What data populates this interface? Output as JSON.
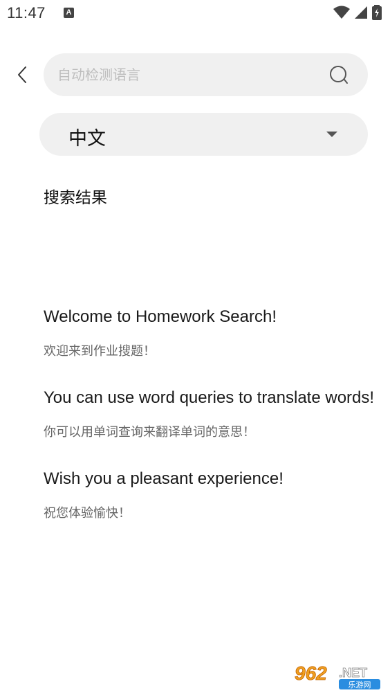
{
  "status_bar": {
    "time": "11:47",
    "notification_badge": "A"
  },
  "search": {
    "placeholder": "自动检测语言",
    "value": ""
  },
  "language_select": {
    "selected": "中文"
  },
  "results": {
    "title": "搜索结果",
    "messages": [
      {
        "en": "Welcome to Homework Search!",
        "zh": "欢迎来到作业搜题！"
      },
      {
        "en": "You can use word queries to translate words!",
        "zh": "你可以用单词查询来翻译单词的意思！"
      },
      {
        "en": "Wish you a pleasant experience!",
        "zh": "祝您体验愉快！"
      }
    ]
  },
  "watermark": {
    "brand": "962.NET",
    "sub": "乐游网"
  },
  "colors": {
    "field_bg": "#f0f0f0",
    "placeholder": "#bdbdbd",
    "secondary_text": "#666666"
  }
}
